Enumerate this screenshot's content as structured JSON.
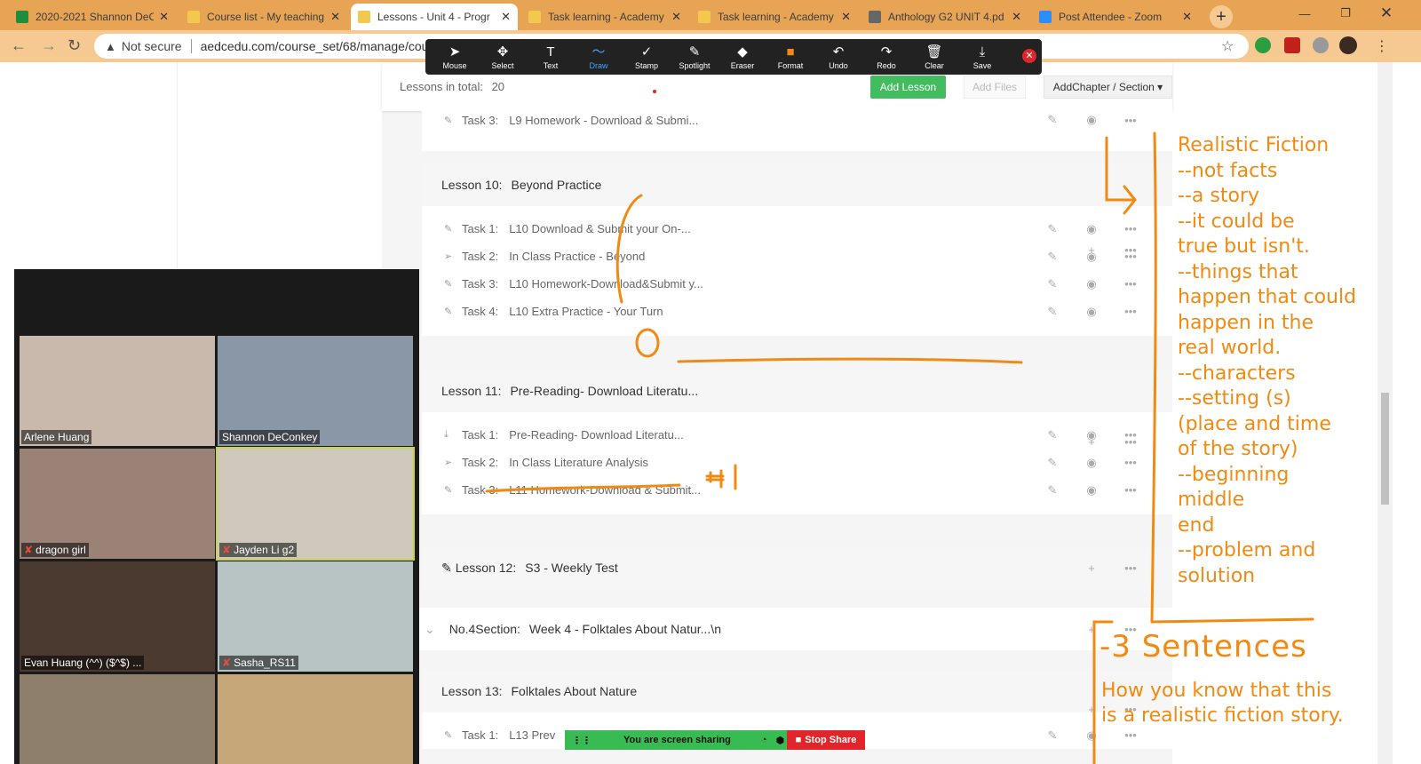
{
  "browser": {
    "tabs": [
      {
        "label": "2020-2021 Shannon DeC",
        "favicon_color": "#1e8e3e",
        "active": false
      },
      {
        "label": "Course list - My teaching",
        "favicon_color": "#f2c94c",
        "active": false
      },
      {
        "label": "Lessons - Unit 4 - Progr",
        "favicon_color": "#f2c94c",
        "active": true
      },
      {
        "label": "Task learning - Academy",
        "favicon_color": "#f2c94c",
        "active": false
      },
      {
        "label": "Task learning - Academy",
        "favicon_color": "#f2c94c",
        "active": false
      },
      {
        "label": "Anthology G2 UNIT 4.pd",
        "favicon_color": "#666666",
        "active": false
      },
      {
        "label": "Post Attendee - Zoom",
        "favicon_color": "#2d8cff",
        "active": false
      }
    ],
    "security_label": "Not secure",
    "url": "aedcedu.com/course_set/68/manage/cou"
  },
  "annotation_toolbar": {
    "buttons": [
      {
        "label": "Mouse",
        "icon": "cursor-icon",
        "glyph": "➤"
      },
      {
        "label": "Select",
        "icon": "move-icon",
        "glyph": "✥"
      },
      {
        "label": "Text",
        "icon": "text-icon",
        "glyph": "T"
      },
      {
        "label": "Draw",
        "icon": "draw-icon",
        "glyph": "〜"
      },
      {
        "label": "Stamp",
        "icon": "check-icon",
        "glyph": "✓"
      },
      {
        "label": "Spotlight",
        "icon": "spotlight-icon",
        "glyph": "✎"
      },
      {
        "label": "Eraser",
        "icon": "eraser-icon",
        "glyph": "◆"
      },
      {
        "label": "Format",
        "icon": "format-icon",
        "glyph": "■"
      },
      {
        "label": "Undo",
        "icon": "undo-icon",
        "glyph": "↶"
      },
      {
        "label": "Redo",
        "icon": "redo-icon",
        "glyph": "↷"
      },
      {
        "label": "Clear",
        "icon": "trash-icon",
        "glyph": "🗑"
      },
      {
        "label": "Save",
        "icon": "save-icon",
        "glyph": "⤓"
      }
    ],
    "active_color": "#43a3ff",
    "format_color": "#f08a12"
  },
  "course": {
    "lessons_total_label": "Lessons in total:",
    "lessons_total": "20",
    "add_lesson": "Add Lesson",
    "add_files": "Add Files",
    "add_chapter": "AddChapter / Section ▾",
    "top_task": {
      "num": "Task 3:",
      "title": "L9 Homework - Download & Submi..."
    },
    "lesson10": {
      "tag": "Lesson 10:",
      "title": "Beyond Practice"
    },
    "lesson10_tasks": [
      {
        "num": "Task 1:",
        "title": "L10 Download & Submit your On-..."
      },
      {
        "num": "Task 2:",
        "title": "In Class Practice - Beyond"
      },
      {
        "num": "Task 3:",
        "title": "L10 Homework-Download&Submit y..."
      },
      {
        "num": "Task 4:",
        "title": "L10 Extra Practice - Your Turn"
      }
    ],
    "lesson11": {
      "tag": "Lesson 11:",
      "title": "Pre-Reading- Download Literatu..."
    },
    "lesson11_tasks": [
      {
        "num": "Task 1:",
        "title": "Pre-Reading- Download Literatu..."
      },
      {
        "num": "Task 2:",
        "title": "In Class Literature Analysis"
      },
      {
        "num": "Task 3:",
        "title": "L11 Homework-Download & Submit..."
      }
    ],
    "lesson12": {
      "tag": "Lesson 12:",
      "title": "S3 - Weekly Test"
    },
    "section4": {
      "tag": "No.4Section:",
      "title": "Week 4 - Folktales About Natur...\\n"
    },
    "lesson13": {
      "tag": "Lesson 13:",
      "title": "Folktales About Nature"
    },
    "lesson13_tasks": [
      {
        "num": "Task 1:",
        "title": "L13 Prev"
      }
    ]
  },
  "zoom": {
    "participants": [
      {
        "name": "Arlene Huang",
        "muted": false,
        "bg": "#c9b9ad"
      },
      {
        "name": "Shannon DeConkey",
        "muted": false,
        "bg": "#8a97a7"
      },
      {
        "name": "dragon girl",
        "muted": true,
        "bg": "#9a8277"
      },
      {
        "name": "Jayden Li g2",
        "muted": true,
        "bg": "#cfc9bd"
      },
      {
        "name": "Evan Huang (^^) ($^$) ...",
        "muted": false,
        "bg": "#4a3a30"
      },
      {
        "name": "Sasha_RS11",
        "muted": true,
        "bg": "#b8c3c3"
      },
      {
        "name": "",
        "muted": false,
        "bg": "#8e7f6c"
      },
      {
        "name": "",
        "muted": false,
        "bg": "#c5a77a"
      }
    ],
    "sharing_label": "You are screen sharing",
    "stop_share": "Stop Share"
  },
  "annotations": {
    "color": "#f08a12",
    "notes": "Realistic Fiction\n--not facts\n--a story\n--it could be\ntrue but isn't.\n--things that\nhappen that could\nhappen in the\nreal world.\n--characters\n--setting (s)\n(place and time\nof the story)\n--beginning\nmiddle\nend\n--problem and\nsolution",
    "sentences": "-3 Sentences",
    "prompt": "How you know that this\nis a realistic fiction story.",
    "mark": "#1"
  }
}
